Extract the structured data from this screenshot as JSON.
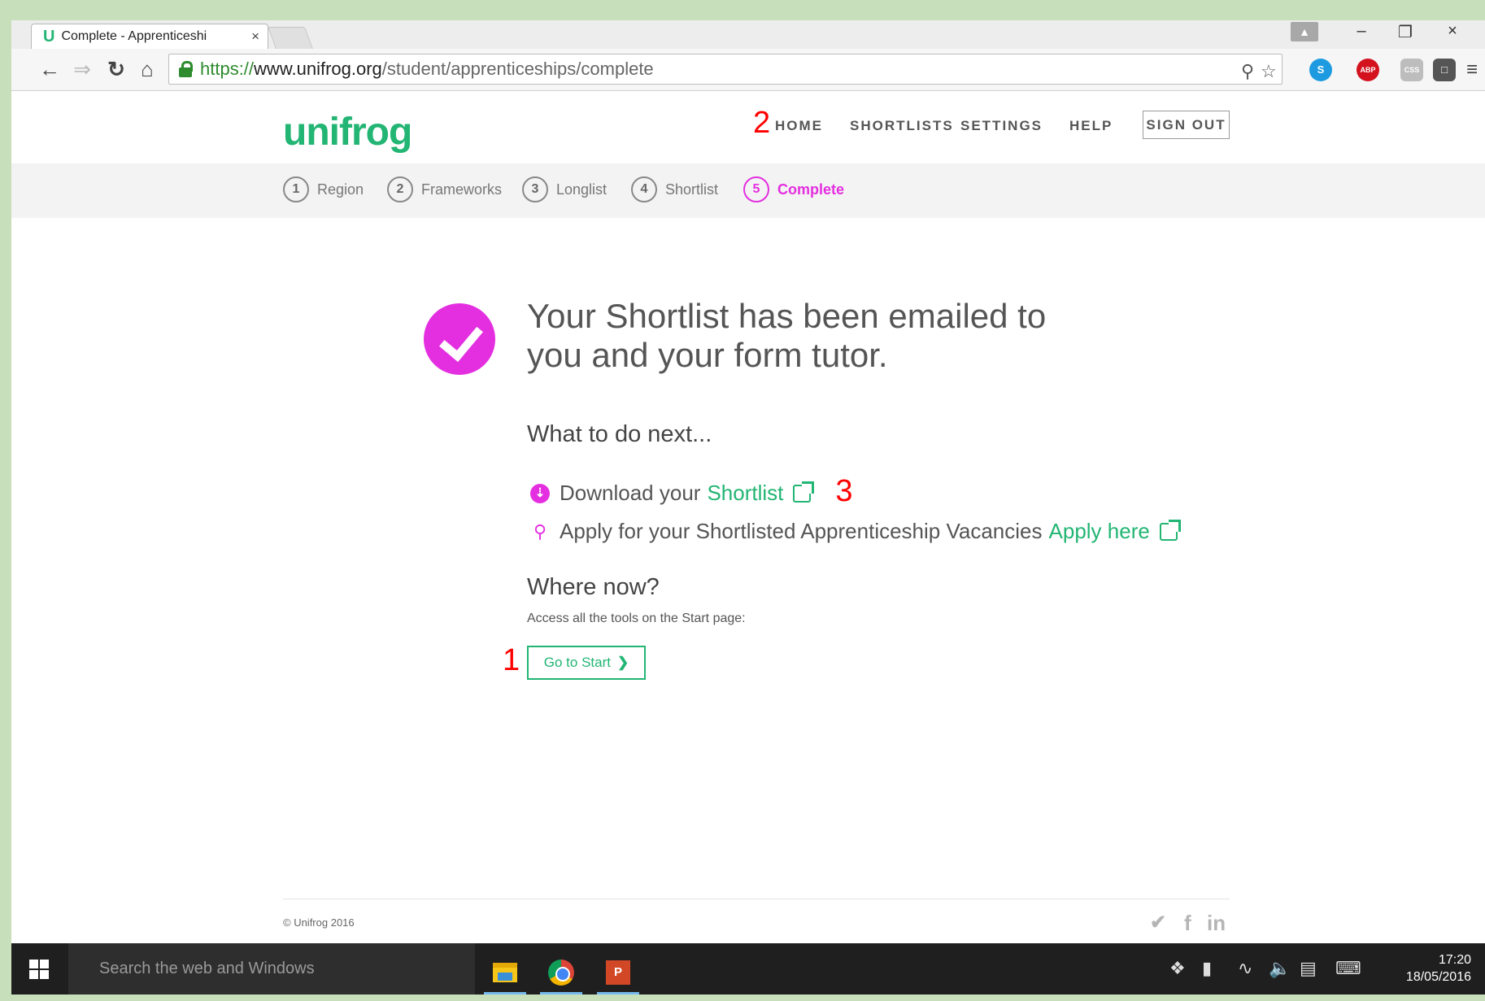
{
  "browser": {
    "tab_title": "Complete - Apprenticeshi",
    "tab_favicon": "U",
    "tab_close": "×",
    "window_minimize": "–",
    "window_restore": "❐",
    "window_close": "×",
    "url_scheme": "https://",
    "url_host": "www.unifrog.org",
    "url_path": "/student/apprenticeships/complete",
    "extensions": {
      "skype": "S",
      "adblock": "ABP",
      "css": "CSS"
    }
  },
  "header": {
    "logo": "unifrog",
    "nav": [
      "HOME",
      "SHORTLISTS",
      "SETTINGS",
      "HELP"
    ],
    "sign_out": "SIGN OUT"
  },
  "annotations": {
    "home_marker": "2",
    "start_marker": "1",
    "download_marker": "3"
  },
  "steps": [
    {
      "num": "1",
      "label": "Region"
    },
    {
      "num": "2",
      "label": "Frameworks"
    },
    {
      "num": "3",
      "label": "Longlist"
    },
    {
      "num": "4",
      "label": "Shortlist"
    },
    {
      "num": "5",
      "label": "Complete"
    }
  ],
  "main": {
    "headline_line1": "Your Shortlist has been emailed to",
    "headline_line2": "you and your form tutor.",
    "next_heading": "What to do next...",
    "download_text": "Download your",
    "download_link": "Shortlist",
    "apply_text": "Apply for your Shortlisted Apprenticeship Vacancies",
    "apply_link": "Apply here",
    "where_heading": "Where now?",
    "where_sub": "Access all the tools on the Start page:",
    "start_button": "Go to Start",
    "start_chevron": "❯"
  },
  "footer": {
    "copyright": "© Unifrog 2016",
    "social": [
      "twitter",
      "f",
      "in"
    ]
  },
  "taskbar": {
    "search_placeholder": "Search the web and Windows",
    "ppt_label": "P",
    "time": "17:20",
    "date": "18/05/2016"
  },
  "colors": {
    "brand_green": "#22b573",
    "accent_magenta": "#e42fe0",
    "annotation_red": "#ff0000"
  }
}
